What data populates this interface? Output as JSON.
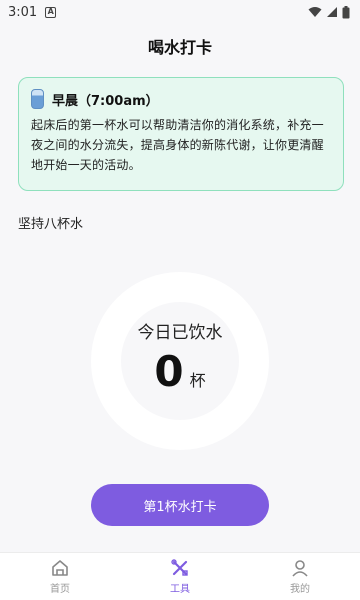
{
  "status_bar": {
    "time": "3:01",
    "notif_letter": "A"
  },
  "header": {
    "title": "喝水打卡"
  },
  "tip_card": {
    "title": "早晨（7:00am）",
    "body": "起床后的第一杯水可以帮助清洁你的消化系统，补充一夜之间的水分流失，提高身体的新陈代谢，让你更清醒地开始一天的活动。",
    "icon": "water-cup-icon"
  },
  "section": {
    "label": "坚持八杯水"
  },
  "ring": {
    "label": "今日已饮水",
    "count": "0",
    "unit": "杯",
    "track_color": "#ffffff",
    "progress_fraction": 0
  },
  "checkin": {
    "label": "第1杯水打卡"
  },
  "nav": {
    "items": [
      {
        "label": "首页",
        "icon": "home-icon",
        "active": false
      },
      {
        "label": "工具",
        "icon": "tools-icon",
        "active": true
      },
      {
        "label": "我的",
        "icon": "profile-icon",
        "active": false
      }
    ]
  },
  "colors": {
    "accent": "#7e5ce0",
    "card_bg": "#e6f8f0",
    "card_border": "#8fe0bd"
  }
}
